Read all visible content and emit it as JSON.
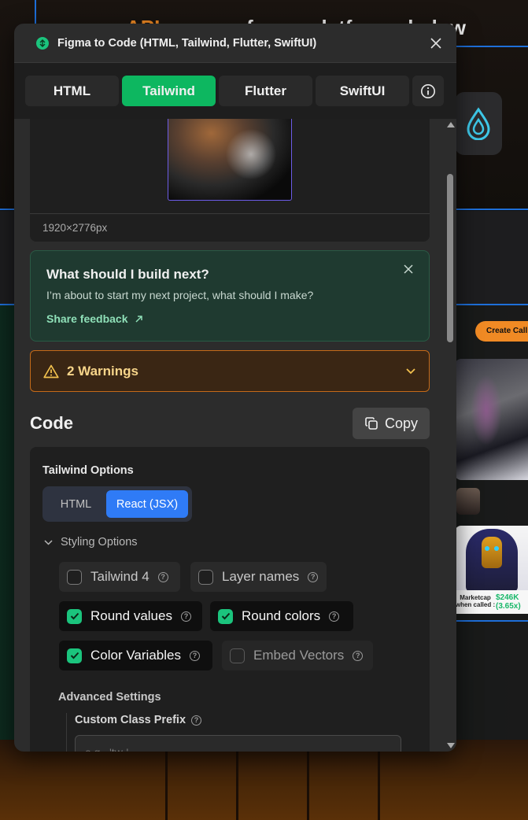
{
  "window": {
    "title": "Figma to Code (HTML, Tailwind, Flutter, SwiftUI)"
  },
  "tabs": [
    {
      "label": "HTML",
      "active": false
    },
    {
      "label": "Tailwind",
      "active": true
    },
    {
      "label": "Flutter",
      "active": false
    },
    {
      "label": "SwiftUI",
      "active": false
    }
  ],
  "preview": {
    "dimensions": "1920×2776px"
  },
  "feedback": {
    "title": "What should I build next?",
    "text": "I’m about to start my next project, what should I make?",
    "link_label": "Share feedback"
  },
  "warnings": {
    "label": "2 Warnings"
  },
  "code": {
    "title": "Code",
    "copy_label": "Copy"
  },
  "tailwind_options": {
    "title": "Tailwind Options",
    "modes": [
      {
        "label": "HTML",
        "active": false
      },
      {
        "label": "React (JSX)",
        "active": true
      }
    ],
    "styling_label": "Styling Options",
    "checkboxes": [
      {
        "label": "Tailwind 4",
        "checked": false
      },
      {
        "label": "Layer names",
        "checked": false
      },
      {
        "label": "Round values",
        "checked": true
      },
      {
        "label": "Round colors",
        "checked": true
      },
      {
        "label": "Color Variables",
        "checked": true
      },
      {
        "label": "Embed Vectors",
        "checked": false
      }
    ],
    "advanced_title": "Advanced Settings",
    "prefix_label": "Custom Class Prefix",
    "prefix_placeholder": "e.g., 'tw-'"
  },
  "background": {
    "heading_accent": "API",
    "heading_rest": " — one of your platforms below",
    "create_button": "Create Call",
    "marketcap_label": "Marketcap when called :",
    "marketcap_value": "$246K",
    "marketcap_change": "(3.65x)"
  },
  "colors": {
    "accent_green": "#0db760",
    "accent_blue": "#2f7bf6",
    "warning_orange": "#c56a18",
    "panel_bg": "#2c2c2c"
  }
}
